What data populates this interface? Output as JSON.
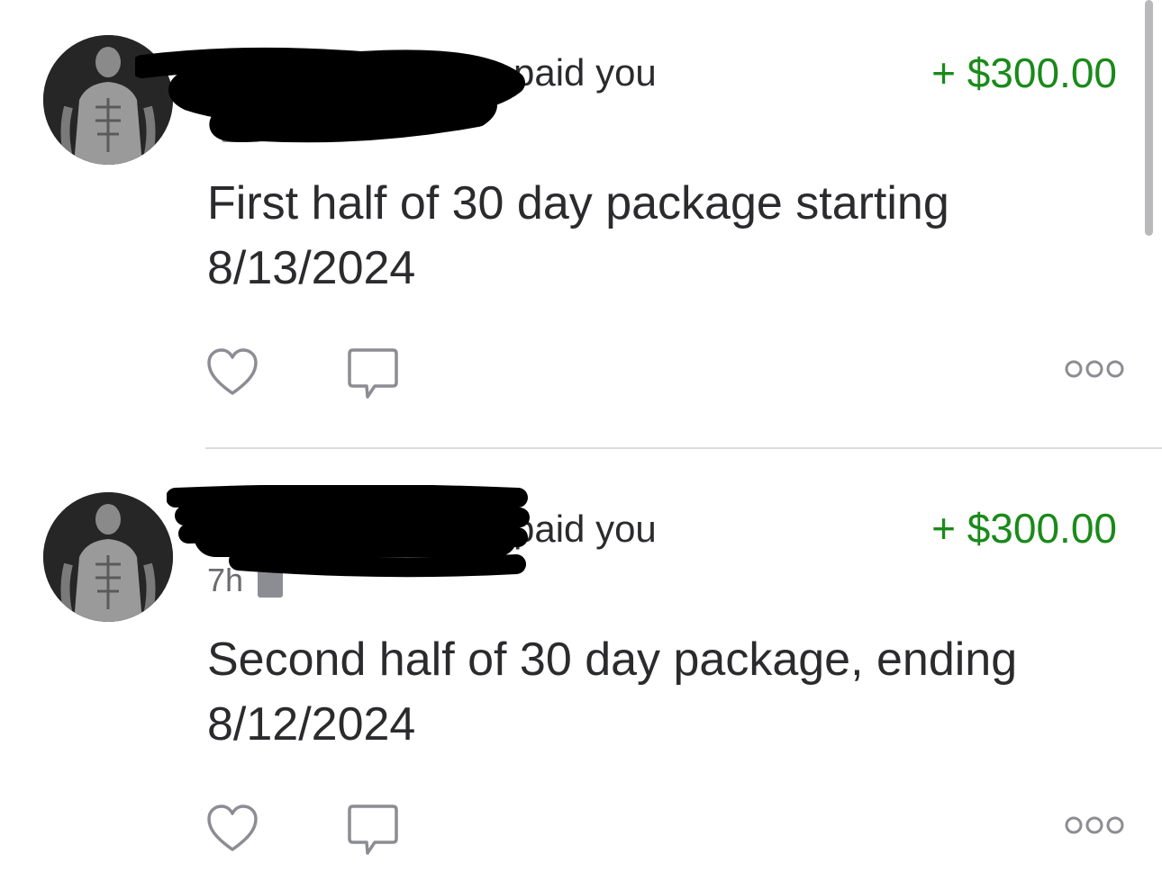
{
  "stories": [
    {
      "headline_suffix": "paid you",
      "amount": "+ $300.00",
      "time": "",
      "note_line1": "First half of 30 day package starting",
      "note_line2": "8/13/2024"
    },
    {
      "headline_suffix": "paid you",
      "amount": "+ $300.00",
      "time": "7h",
      "note_line1": "Second half of 30 day package, ending",
      "note_line2": "8/12/2024"
    }
  ],
  "icons": {
    "like": "heart-icon",
    "comment": "comment-bubble-icon",
    "more": "more-dots-icon"
  },
  "colors": {
    "amount_positive": "#1a8a1a",
    "text_primary": "#2b2b2e",
    "text_secondary": "#6b6b70",
    "icon_gray": "#8c8c93"
  }
}
